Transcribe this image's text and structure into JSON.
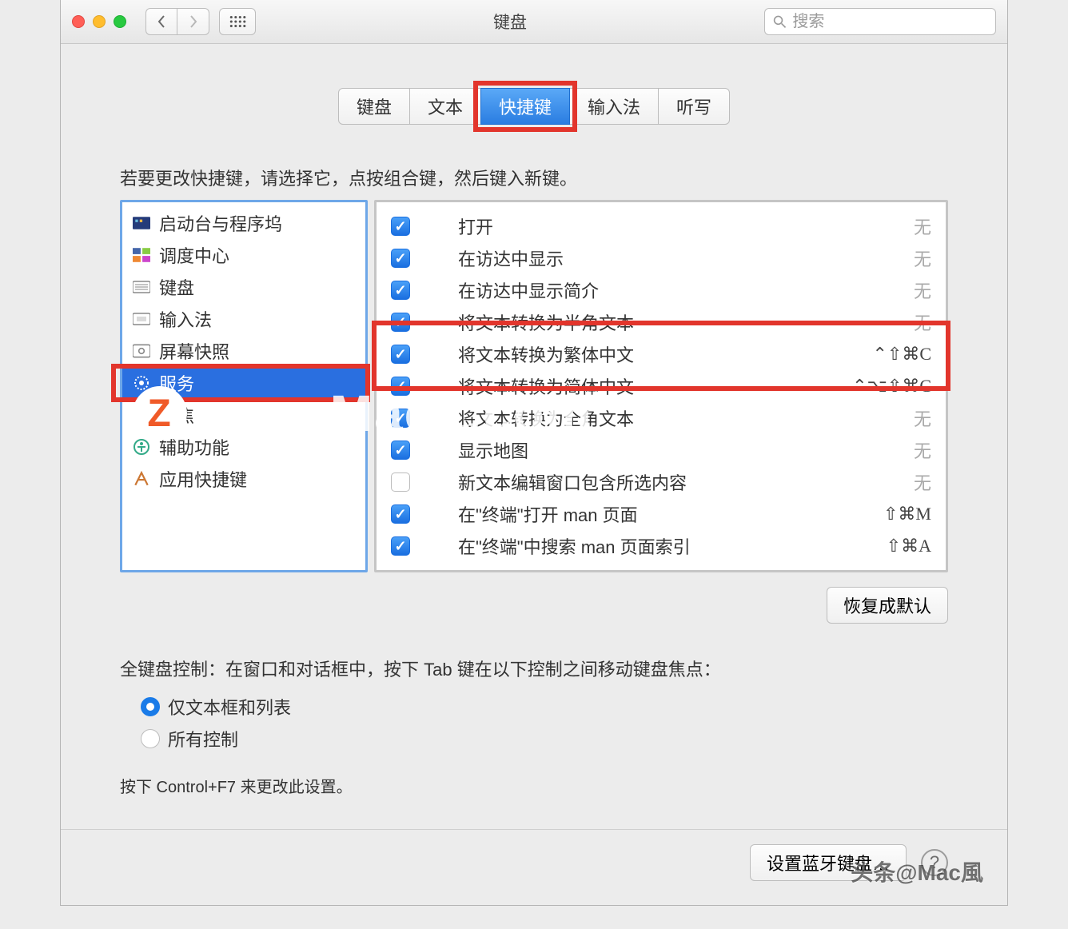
{
  "title": "键盘",
  "search_placeholder": "搜索",
  "tabs": [
    "键盘",
    "文本",
    "快捷键",
    "输入法",
    "听写"
  ],
  "active_tab_index": 2,
  "instruction": "若要更改快捷键，请选择它，点按组合键，然后键入新键。",
  "sidebar": {
    "items": [
      {
        "label": "启动台与程序坞"
      },
      {
        "label": "调度中心"
      },
      {
        "label": "键盘"
      },
      {
        "label": "输入法"
      },
      {
        "label": "屏幕快照"
      },
      {
        "label": "服务"
      },
      {
        "label": "聚焦"
      },
      {
        "label": "辅助功能"
      },
      {
        "label": "应用快捷键"
      }
    ],
    "selected_index": 5
  },
  "rows": [
    {
      "checked": true,
      "label": "打开",
      "shortcut": "无",
      "none": true
    },
    {
      "checked": true,
      "label": "在访达中显示",
      "shortcut": "无",
      "none": true
    },
    {
      "checked": true,
      "label": "在访达中显示简介",
      "shortcut": "无",
      "none": true
    },
    {
      "checked": true,
      "label": "将文本转换为半角文本",
      "shortcut": "无",
      "none": true
    },
    {
      "checked": true,
      "label": "将文本转换为繁体中文",
      "shortcut": "⌃⇧⌘C",
      "none": false
    },
    {
      "checked": true,
      "label": "将文本转换为简体中文",
      "shortcut": "⌃⌥⇧⌘C",
      "none": false
    },
    {
      "checked": true,
      "label": "将文本转换为全角文本",
      "shortcut": "无",
      "none": true
    },
    {
      "checked": true,
      "label": "显示地图",
      "shortcut": "无",
      "none": true
    },
    {
      "checked": false,
      "label": "新文本编辑窗口包含所选内容",
      "shortcut": "无",
      "none": true
    },
    {
      "checked": true,
      "label": "在\"终端\"打开 man 页面",
      "shortcut": "⇧⌘M",
      "none": false
    },
    {
      "checked": true,
      "label": "在\"终端\"中搜索 man 页面索引",
      "shortcut": "⇧⌘A",
      "none": false
    }
  ],
  "restore_label": "恢复成默认",
  "footer_text": "全键盘控制：在窗口和对话框中，按下 Tab 键在以下控制之间移动键盘焦点：",
  "radio1": "仅文本框和列表",
  "radio2": "所有控制",
  "hint": "按下 Control+F7 来更改此设置。",
  "bt_button": "设置蓝牙键盘…",
  "watermark_bottom": "头条@Mac風",
  "watermark_center": "www.MacZ.com"
}
